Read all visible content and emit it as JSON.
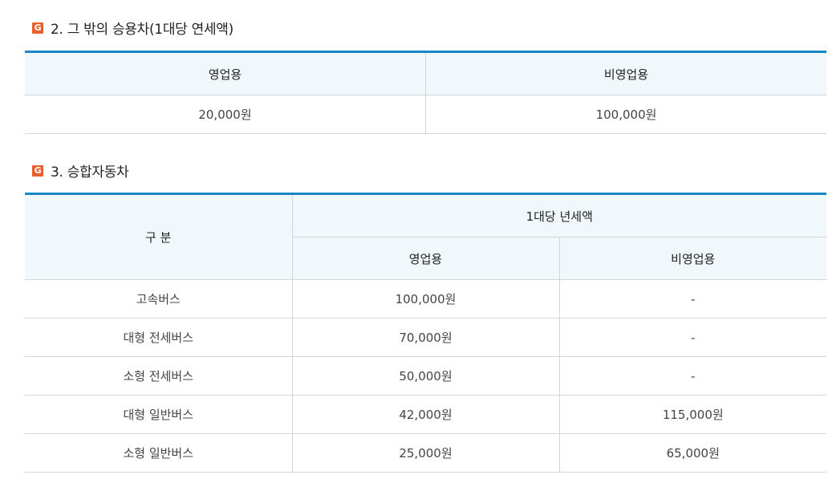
{
  "section1": {
    "icon_letter": "G",
    "title": "2. 그 밖의 승용차(1대당 연세액)",
    "headers": [
      "영업용",
      "비영업용"
    ],
    "values": [
      "20,000원",
      "100,000원"
    ]
  },
  "section2": {
    "icon_letter": "G",
    "title": "3. 승합자동차",
    "header_category": "구 분",
    "header_group": "1대당 년세액",
    "header_business": "영업용",
    "header_nonbusiness": "비영업용",
    "rows": [
      {
        "category": "고속버스",
        "business": "100,000원",
        "nonbusiness": "-"
      },
      {
        "category": "대형 전세버스",
        "business": "70,000원",
        "nonbusiness": "-"
      },
      {
        "category": "소형 전세버스",
        "business": "50,000원",
        "nonbusiness": "-"
      },
      {
        "category": "대형 일반버스",
        "business": "42,000원",
        "nonbusiness": "115,000원"
      },
      {
        "category": "소형 일반버스",
        "business": "25,000원",
        "nonbusiness": "65,000원"
      }
    ]
  },
  "colors": {
    "accent_line": "#1787c6",
    "header_bg": "#f1f8fb",
    "icon_bg": "#e8612c"
  }
}
